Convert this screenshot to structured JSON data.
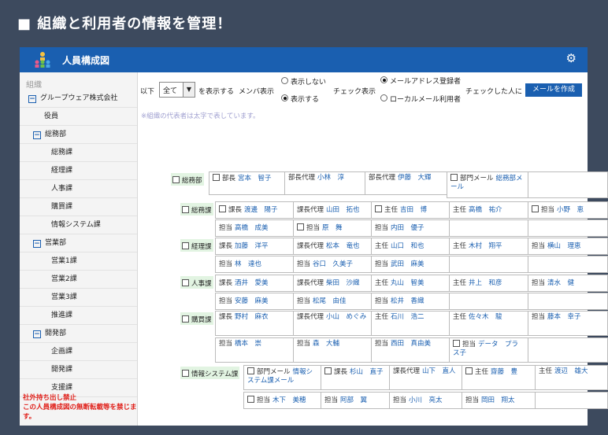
{
  "heading": "■ 組織と利用者の情報を管理！",
  "app": {
    "title": "人員構成図"
  },
  "sidebar": {
    "header": "組織",
    "items": [
      {
        "label": "グループウェア株式会社",
        "level": 0,
        "toggle": "−"
      },
      {
        "label": "役員",
        "level": 1,
        "toggle": ""
      },
      {
        "label": "総務部",
        "level": 1,
        "toggle": "−"
      },
      {
        "label": "総務課",
        "level": 2,
        "toggle": ""
      },
      {
        "label": "経理課",
        "level": 2,
        "toggle": ""
      },
      {
        "label": "人事課",
        "level": 2,
        "toggle": ""
      },
      {
        "label": "購買課",
        "level": 2,
        "toggle": ""
      },
      {
        "label": "情報システム課",
        "level": 2,
        "toggle": ""
      },
      {
        "label": "営業部",
        "level": 1,
        "toggle": "−"
      },
      {
        "label": "営業1課",
        "level": 2,
        "toggle": ""
      },
      {
        "label": "営業2課",
        "level": 2,
        "toggle": ""
      },
      {
        "label": "営業3課",
        "level": 2,
        "toggle": ""
      },
      {
        "label": "推進課",
        "level": 2,
        "toggle": ""
      },
      {
        "label": "開発部",
        "level": 1,
        "toggle": "−"
      },
      {
        "label": "企画課",
        "level": 2,
        "toggle": ""
      },
      {
        "label": "開発課",
        "level": 2,
        "toggle": ""
      },
      {
        "label": "支援課",
        "level": 2,
        "toggle": ""
      }
    ],
    "warning": "社外持ち出し禁止\nこの人員構成図の無断転載等を禁じます。"
  },
  "toolbar": {
    "prefix": "以下",
    "select_value": "全て",
    "suffix": "を表示する",
    "member_label": "メンバ表示",
    "hide_label": "表示しない",
    "show_label": "表示する",
    "check_label": "チェック表示",
    "mail_registered": "メールアドレス登録者",
    "local_mail": "ローカルメール利用者",
    "checked_label": "チェックした人に",
    "create_mail": "メールを作成"
  },
  "note": "※組織の代表者は太字で表しています。",
  "org": {
    "department": "総務部",
    "dept_members": [
      {
        "role": "部長",
        "name": "宮本　智子",
        "cb": true
      },
      {
        "role": "部長代理",
        "name": "小林　淳",
        "cb": false
      },
      {
        "role": "部長代理",
        "name": "伊藤　大輝",
        "cb": false
      },
      {
        "role": "部門メール",
        "name": "総務部",
        "extra": "メール",
        "cb": true
      }
    ],
    "sections": [
      {
        "name": "総務課",
        "rows": [
          [
            {
              "role": "課長",
              "name": "渡邊　陽子",
              "cb": true
            },
            {
              "role": "課長代理",
              "name": "山田　拓也"
            },
            {
              "role": "主任",
              "name": "吉田　博",
              "cb": true
            },
            {
              "role": "主任",
              "name": "高橋　祐介"
            },
            {
              "role": "担当",
              "name": "小野　恵",
              "cb": true
            }
          ],
          [
            {
              "role": "担当",
              "name": "高橋　成美"
            },
            {
              "role": "担当",
              "name": "原　舞",
              "cb": true
            },
            {
              "role": "担当",
              "name": "内田　優子"
            }
          ]
        ]
      },
      {
        "name": "経理課",
        "rows": [
          [
            {
              "role": "課長",
              "name": "加藤　洋平"
            },
            {
              "role": "課長代理",
              "name": "松本　竜也"
            },
            {
              "role": "主任",
              "name": "山口　和也"
            },
            {
              "role": "主任",
              "name": "木村　翔平"
            },
            {
              "role": "担当",
              "name": "横山　理恵"
            }
          ],
          [
            {
              "role": "担当",
              "name": "林　達也"
            },
            {
              "role": "担当",
              "name": "谷口　久美子"
            },
            {
              "role": "担当",
              "name": "武田　麻美"
            }
          ]
        ]
      },
      {
        "name": "人事課",
        "rows": [
          [
            {
              "role": "課長",
              "name": "酒井　愛美"
            },
            {
              "role": "課長代理",
              "name": "柴田　沙織"
            },
            {
              "role": "主任",
              "name": "丸山　智美"
            },
            {
              "role": "主任",
              "name": "井上　和彦"
            },
            {
              "role": "担当",
              "name": "清水　健"
            }
          ],
          [
            {
              "role": "担当",
              "name": "安藤　麻美"
            },
            {
              "role": "担当",
              "name": "松尾　由佳"
            },
            {
              "role": "担当",
              "name": "松井　香織"
            }
          ]
        ]
      },
      {
        "name": "購買課",
        "rows": [
          [
            {
              "role": "課長",
              "name": "野村　麻衣"
            },
            {
              "role": "課長代理",
              "name": "小山　めぐみ"
            },
            {
              "role": "主任",
              "name": "石川　浩二"
            },
            {
              "role": "主任",
              "name": "佐々木　駿"
            },
            {
              "role": "担当",
              "name": "藤本　幸子"
            }
          ],
          [
            {
              "role": "担当",
              "name": "橋本　崇"
            },
            {
              "role": "担当",
              "name": "森　大輔"
            },
            {
              "role": "担当",
              "name": "西田　真由美"
            },
            {
              "role": "担当",
              "name": "データ　プラス子",
              "cb": true
            }
          ]
        ]
      },
      {
        "name": "情報システム課",
        "rows": [
          [
            {
              "role": "部門メール",
              "name": "情報システム課メール",
              "cb": true
            },
            {
              "role": "課長",
              "name": "杉山　直子",
              "cb": true
            },
            {
              "role": "課長代理",
              "name": "山下　直人"
            },
            {
              "role": "主任",
              "name": "齋藤　豊",
              "cb": true
            },
            {
              "role": "主任",
              "name": "渡辺　雄大"
            }
          ],
          [
            {
              "role": "担当",
              "name": "木下　美穂",
              "cb": true
            },
            {
              "role": "担当",
              "name": "阿部　翼"
            },
            {
              "role": "担当",
              "name": "小川　亮太"
            },
            {
              "role": "担当",
              "name": "岡田　翔太"
            }
          ]
        ]
      }
    ]
  }
}
